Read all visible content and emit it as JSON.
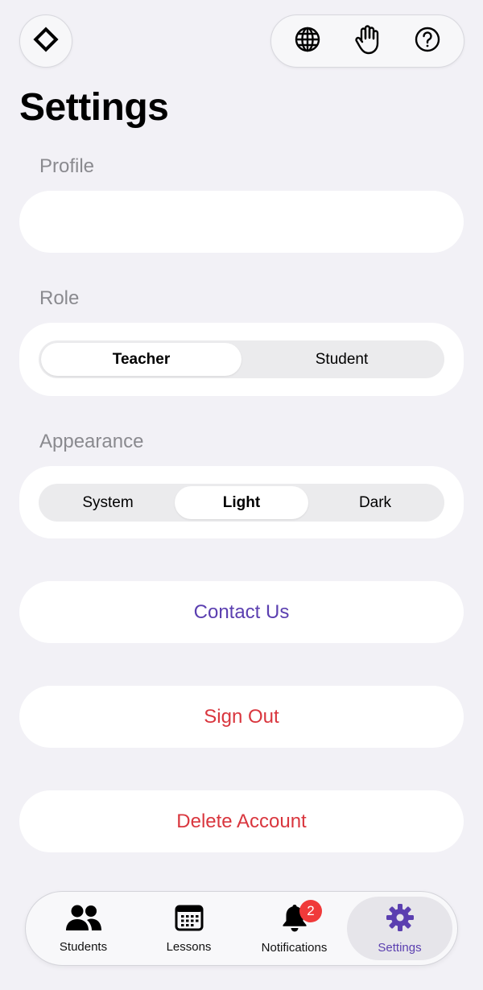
{
  "header": {
    "logo_icon": "diamond-icon",
    "actions": [
      {
        "name": "language",
        "icon": "globe-icon"
      },
      {
        "name": "raise-hand",
        "icon": "hand-icon"
      },
      {
        "name": "help",
        "icon": "question-circle-icon"
      }
    ]
  },
  "page": {
    "title": "Settings"
  },
  "profile": {
    "label": "Profile"
  },
  "role": {
    "label": "Role",
    "options": [
      "Teacher",
      "Student"
    ],
    "selected": "Teacher"
  },
  "appearance": {
    "label": "Appearance",
    "options": [
      "System",
      "Light",
      "Dark"
    ],
    "selected": "Light"
  },
  "actions": {
    "contact": "Contact Us",
    "sign_out": "Sign Out",
    "delete": "Delete Account"
  },
  "colors": {
    "accent": "#5b3fb0",
    "destructive": "#d9363e",
    "background": "#f2f1f6",
    "badge": "#f03a3a"
  },
  "tabbar": {
    "tabs": [
      {
        "label": "Students",
        "icon": "people-icon"
      },
      {
        "label": "Lessons",
        "icon": "calendar-icon"
      },
      {
        "label": "Notifications",
        "icon": "bell-icon",
        "badge": "2"
      },
      {
        "label": "Settings",
        "icon": "gear-icon"
      }
    ],
    "active": "Settings"
  }
}
